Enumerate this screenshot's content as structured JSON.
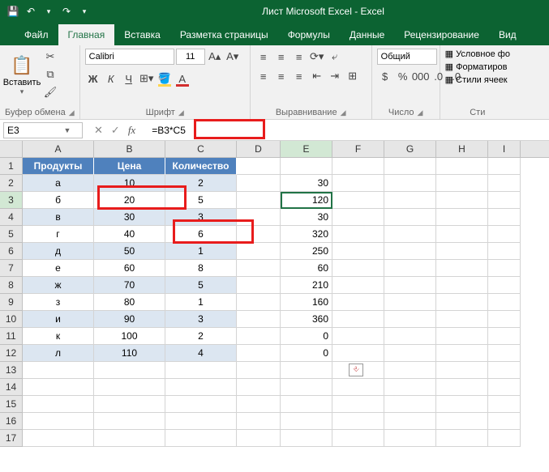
{
  "app": {
    "title": "Лист Microsoft Excel - Excel"
  },
  "qat": {
    "save": "💾",
    "undo": "↶",
    "redo": "↷",
    "more": "▾"
  },
  "tabs": {
    "file": "Файл",
    "home": "Главная",
    "insert": "Вставка",
    "layout": "Разметка страницы",
    "formulas": "Формулы",
    "data": "Данные",
    "review": "Рецензирование",
    "view": "Вид"
  },
  "ribbon": {
    "clipboard": {
      "paste": "Вставить",
      "label": "Буфер обмена"
    },
    "font": {
      "name": "Calibri",
      "size": "11",
      "label": "Шрифт",
      "bold": "Ж",
      "italic": "К",
      "underline": "Ч"
    },
    "align": {
      "label": "Выравнивание",
      "wrap": "⤶",
      "merge": "⊞"
    },
    "number": {
      "format": "Общий",
      "label": "Число"
    },
    "styles": {
      "cond": "Условное фо",
      "table": "Форматиров",
      "cell": "Стили ячеек",
      "label": "Сти"
    }
  },
  "formula_bar": {
    "cell_ref": "E3",
    "formula": "=B3*C5"
  },
  "columns": [
    "A",
    "B",
    "C",
    "D",
    "E",
    "F",
    "G",
    "H",
    "I"
  ],
  "headers": {
    "a": "Продукты",
    "b": "Цена",
    "c": "Количество"
  },
  "rows": [
    {
      "r": "1"
    },
    {
      "r": "2",
      "a": "а",
      "b": "10",
      "c": "2",
      "e": "30"
    },
    {
      "r": "3",
      "a": "б",
      "b": "20",
      "c": "5",
      "e": "120"
    },
    {
      "r": "4",
      "a": "в",
      "b": "30",
      "c": "3",
      "e": "30"
    },
    {
      "r": "5",
      "a": "г",
      "b": "40",
      "c": "6",
      "e": "320"
    },
    {
      "r": "6",
      "a": "д",
      "b": "50",
      "c": "1",
      "e": "250"
    },
    {
      "r": "7",
      "a": "е",
      "b": "60",
      "c": "8",
      "e": "60"
    },
    {
      "r": "8",
      "a": "ж",
      "b": "70",
      "c": "5",
      "e": "210"
    },
    {
      "r": "9",
      "a": "з",
      "b": "80",
      "c": "1",
      "e": "160"
    },
    {
      "r": "10",
      "a": "и",
      "b": "90",
      "c": "3",
      "e": "360"
    },
    {
      "r": "11",
      "a": "к",
      "b": "100",
      "c": "2",
      "e": "0"
    },
    {
      "r": "12",
      "a": "л",
      "b": "110",
      "c": "4",
      "e": "0"
    },
    {
      "r": "13"
    },
    {
      "r": "14"
    },
    {
      "r": "15"
    },
    {
      "r": "16"
    },
    {
      "r": "17"
    }
  ],
  "chart_data": {
    "type": "table",
    "title": "",
    "columns": [
      "Продукты",
      "Цена",
      "Количество",
      "E"
    ],
    "rows": [
      [
        "а",
        10,
        2,
        30
      ],
      [
        "б",
        20,
        5,
        120
      ],
      [
        "в",
        30,
        3,
        30
      ],
      [
        "г",
        40,
        6,
        320
      ],
      [
        "д",
        50,
        1,
        250
      ],
      [
        "е",
        60,
        8,
        60
      ],
      [
        "ж",
        70,
        5,
        210
      ],
      [
        "з",
        80,
        1,
        160
      ],
      [
        "и",
        90,
        3,
        360
      ],
      [
        "к",
        100,
        2,
        0
      ],
      [
        "л",
        110,
        4,
        0
      ]
    ]
  }
}
